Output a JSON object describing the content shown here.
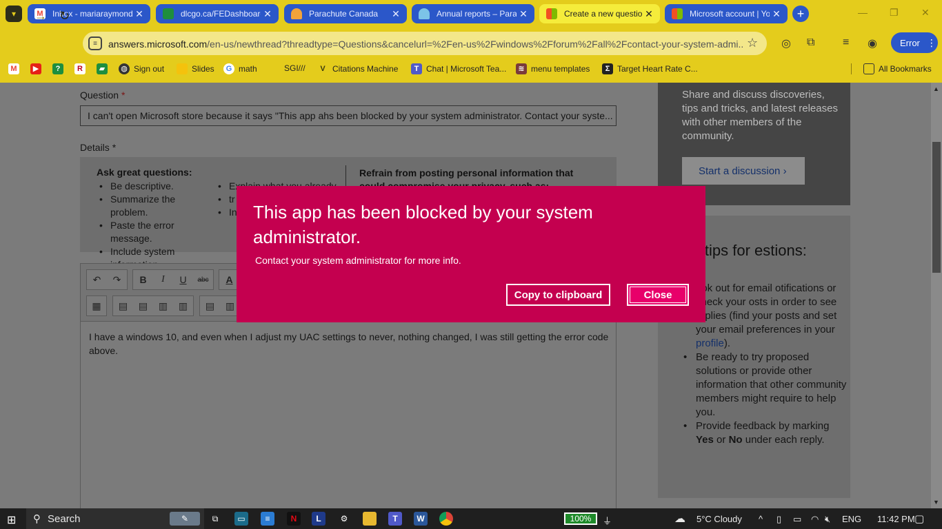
{
  "tabs": [
    {
      "label": "Inbox - mariaraymond",
      "favicon": "gmail-icon",
      "color": "#ea4335"
    },
    {
      "label": "dlcgo.ca/FEDashboard",
      "favicon": "sheet-icon",
      "color": "#1e8e3e"
    },
    {
      "label": "Parachute Canada",
      "favicon": "parachute-icon",
      "color": "#f2a33a"
    },
    {
      "label": "Annual reports – Parachute",
      "favicon": "umbrella-icon",
      "color": "#7cc4e8"
    },
    {
      "label": "Create a new question",
      "favicon": "microsoft-icon",
      "color": "#f25022",
      "active": true
    },
    {
      "label": "Microsoft account | Yo",
      "favicon": "microsoft-icon",
      "color": "#f25022"
    }
  ],
  "toolbar": {
    "url_host": "answers.microsoft.com",
    "url_path": "/en-us/newthread?threadtype=Questions&cancelurl=%2Fen-us%2Fwindows%2Fforum%2Fall%2Fcontact-your-system-admi...",
    "profile_button": "Error"
  },
  "bookmarks": [
    {
      "label": "",
      "icon": "gmail-icon"
    },
    {
      "label": "",
      "icon": "youtube-icon"
    },
    {
      "label": "",
      "icon": "maps-icon"
    },
    {
      "label": "",
      "icon": "r-icon"
    },
    {
      "label": "",
      "icon": "classroom-icon"
    },
    {
      "label": "Sign out",
      "icon": "globe-icon"
    },
    {
      "label": "Slides",
      "icon": "slides-icon"
    },
    {
      "label": "math",
      "icon": "google-icon"
    },
    {
      "label": "SGI///",
      "icon": "none"
    },
    {
      "label": "Citations Machine",
      "icon": "citation-icon"
    },
    {
      "label": "Chat | Microsoft Tea...",
      "icon": "teams-icon"
    },
    {
      "label": "menu templates",
      "icon": "layers-icon"
    },
    {
      "label": "Target Heart Rate C...",
      "icon": "sigma-icon"
    },
    {
      "label": "All Bookmarks",
      "icon": "folder-icon"
    }
  ],
  "form": {
    "question_label": "Question",
    "required_mark": "*",
    "question_value": "I can't open Microsoft store because it says \"This app ahs been blocked by your system administrator. Contact your syste...",
    "details_label": "Details",
    "tips_title": "Ask great questions:",
    "tips_col1": [
      "Be descriptive.",
      "Summarize the problem.",
      "Paste the error message.",
      "Include system information."
    ],
    "tips_col2": [
      "Explain what you already",
      "tr",
      "In"
    ],
    "refrain_text": "Refrain from posting personal information that could compromise your privacy, such as:",
    "editor_text": "I have a windows 10, and even when I adjust my UAC settings to never, nothing changed, I was still getting the error code above."
  },
  "sidebar": {
    "card1_text": "Share and discuss discoveries, tips and tricks, and latest releases with other members of the community.",
    "card1_button": "Start a discussion",
    "card2_title": "her tips for estions:",
    "card2_items": [
      {
        "pre": "ook out for email otifications or check your osts in order to see replies (find your posts and set your email preferences in your ",
        "link": "profile",
        "post": ")."
      },
      {
        "pre": "Be ready to try proposed solutions or provide other information that other community members might require to help you.",
        "link": "",
        "post": ""
      },
      {
        "pre": "Provide feedback by marking ",
        "link": "",
        "post": "",
        "yes": "Yes",
        "or": " or ",
        "no": "No",
        "tail": " under each reply."
      }
    ]
  },
  "dialog": {
    "title": "This app has been blocked by your system administrator.",
    "subtitle": "Contact your system administrator for more info.",
    "copy_button": "Copy to clipboard",
    "close_button": "Close",
    "background": "#c4004f"
  },
  "taskbar": {
    "search_placeholder": "Search",
    "battery": "100%",
    "weather": "5°C  Cloudy",
    "language": "ENG",
    "time": "11:42 PM"
  }
}
